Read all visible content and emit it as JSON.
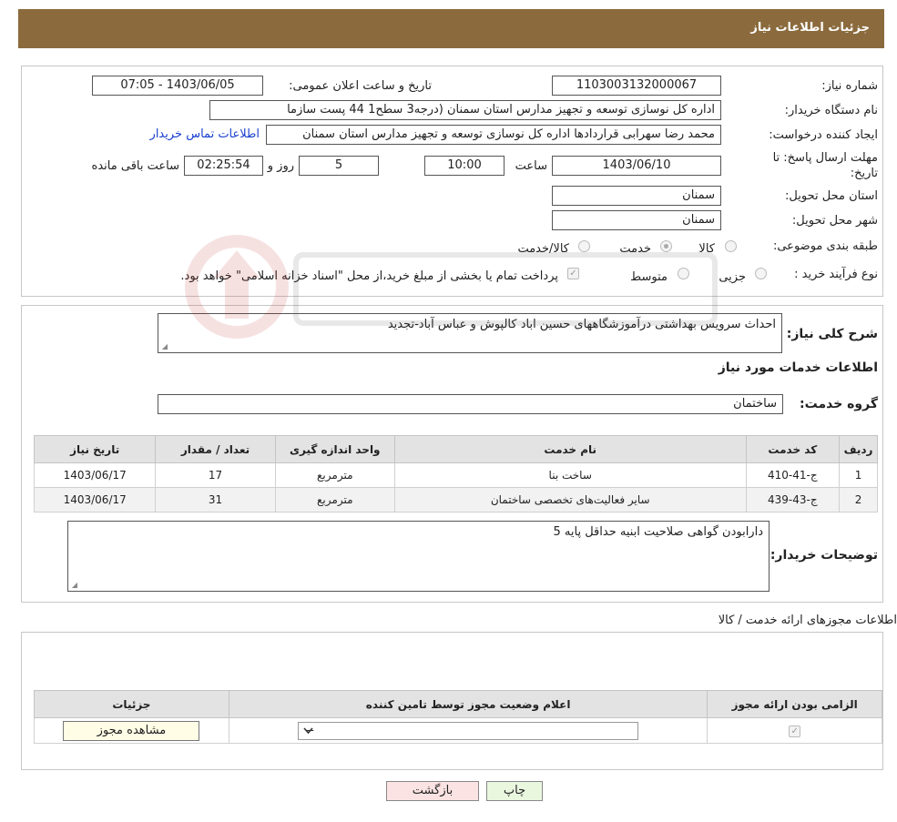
{
  "header": {
    "title": "جزئیات اطلاعات نیاز"
  },
  "details": {
    "need_number_label": "شماره نیاز:",
    "need_number": "1103003132000067",
    "announce_label": "تاریخ و ساعت اعلان عمومی:",
    "announce_value": "1403/06/05 - 07:05",
    "buyer_org_label": "نام دستگاه خریدار:",
    "buyer_org": "اداره کل نوسازی   توسعه و تجهیز مدارس استان سمنان (درجه3  سطح1  44 پست سازما",
    "requester_label": "ایجاد کننده درخواست:",
    "requester": "محمد رضا سهرابی قراردادها اداره کل نوسازی   توسعه و تجهیز مدارس استان سمنان",
    "contact_link": "اطلاعات تماس خریدار",
    "deadline_label_1": "مهلت ارسال پاسخ: تا",
    "deadline_label_2": "تاریخ:",
    "deadline_date": "1403/06/10",
    "time_label": "ساعت",
    "deadline_time": "10:00",
    "days_value": "5",
    "days_label": "روز و",
    "remaining_time": "02:25:54",
    "remaining_label": "ساعت باقی مانده",
    "province_label": "استان محل تحویل:",
    "province": "سمنان",
    "city_label": "شهر محل تحویل:",
    "city": "سمنان",
    "category_label": "طبقه بندی موضوعی:",
    "category_options": [
      "کالا",
      "خدمت",
      "کالا/خدمت"
    ],
    "category_selected": "خدمت",
    "purchase_type_label": "نوع فرآیند خرید :",
    "purchase_options": [
      "جزیی",
      "متوسط"
    ],
    "purchase_note": "پرداخت تمام یا بخشی از مبلغ خرید،از محل \"اسناد خزانه اسلامی\" خواهد بود."
  },
  "services": {
    "summary_label": "شرح کلی نیاز:",
    "summary": "احداث سرویس بهداشتی درآموزشگاههای حسین اباد کالپوش  و عباس آباد-تجدید",
    "section_title": "اطلاعات خدمات مورد نیاز",
    "group_label": "گروه خدمت:",
    "group_value": "ساختمان",
    "columns": [
      "ردیف",
      "کد خدمت",
      "نام خدمت",
      "واحد اندازه گیری",
      "تعداد / مقدار",
      "تاریخ نیاز"
    ],
    "rows": [
      [
        "1",
        "ج-41-410",
        "ساخت بنا",
        "مترمربع",
        "17",
        "1403/06/17"
      ],
      [
        "2",
        "ج-43-439",
        "سایر فعالیت‌های تخصصی ساختمان",
        "مترمربع",
        "31",
        "1403/06/17"
      ]
    ],
    "buyer_notes_label": "توضیحات خریدار:",
    "buyer_notes": "دارابودن گواهی صلاحیت ابنیه حداقل پایه 5"
  },
  "permits": {
    "section_title": "اطلاعات مجوزهای ارائه خدمت / کالا",
    "columns": [
      "الزامی بودن ارائه مجوز",
      "اعلام وضعیت مجوز توسط تامین کننده",
      "جزئیات"
    ],
    "select_value": "--",
    "view_button": "مشاهده مجوز"
  },
  "actions": {
    "print": "چاپ",
    "back": "بازگشت"
  },
  "colors": {
    "header": "#8b6b3d",
    "link": "#1a3fd0",
    "table_header": "#e3e3e3"
  }
}
